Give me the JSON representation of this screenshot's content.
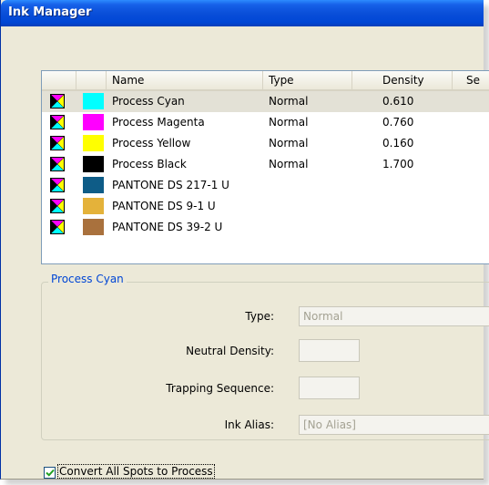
{
  "window": {
    "title": "Ink Manager"
  },
  "list": {
    "headers": {
      "name": "Name",
      "type": "Type",
      "density": "Density",
      "sequence": "Se"
    },
    "rows": [
      {
        "name": "Process Cyan",
        "type": "Normal",
        "density": "0.610",
        "color": "#00FFFF",
        "selected": true
      },
      {
        "name": "Process Magenta",
        "type": "Normal",
        "density": "0.760",
        "color": "#FF00FF"
      },
      {
        "name": "Process Yellow",
        "type": "Normal",
        "density": "0.160",
        "color": "#FFFF00"
      },
      {
        "name": "Process Black",
        "type": "Normal",
        "density": "1.700",
        "color": "#000000"
      },
      {
        "name": "PANTONE DS 217-1 U",
        "type": "",
        "density": "",
        "color": "#0E5C87"
      },
      {
        "name": "PANTONE DS 9-1 U",
        "type": "",
        "density": "",
        "color": "#E4B23A"
      },
      {
        "name": "PANTONE DS 39-2 U",
        "type": "",
        "density": "",
        "color": "#A9713D"
      }
    ],
    "ink_type_icon": "process-ink-icon"
  },
  "details": {
    "group_title": "Process Cyan",
    "type_label": "Type:",
    "type_value": "Normal",
    "neutral_density_label": "Neutral Density:",
    "neutral_density_value": "",
    "trapping_sequence_label": "Trapping Sequence:",
    "trapping_sequence_value": "",
    "ink_alias_label": "Ink Alias:",
    "ink_alias_value": "[No Alias]"
  },
  "convert_all": {
    "label": "Convert All Spots to Process",
    "checked": true
  },
  "colors": {
    "title_bar": "#0046D5",
    "dialog_bg": "#ECE9D8",
    "group_title": "#0046D5"
  }
}
